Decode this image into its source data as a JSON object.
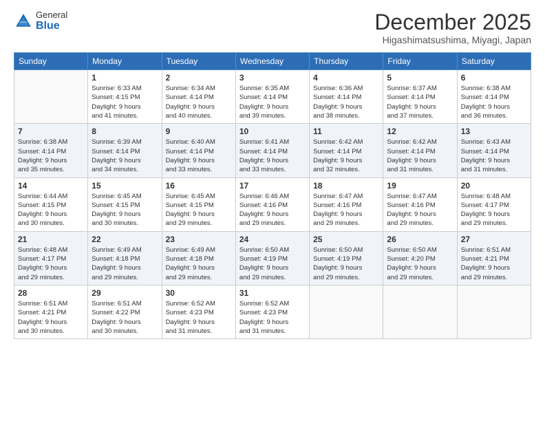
{
  "logo": {
    "general": "General",
    "blue": "Blue"
  },
  "title": "December 2025",
  "location": "Higashimatsushima, Miyagi, Japan",
  "days_header": [
    "Sunday",
    "Monday",
    "Tuesday",
    "Wednesday",
    "Thursday",
    "Friday",
    "Saturday"
  ],
  "weeks": [
    [
      {
        "day": "",
        "info": ""
      },
      {
        "day": "1",
        "info": "Sunrise: 6:33 AM\nSunset: 4:15 PM\nDaylight: 9 hours\nand 41 minutes."
      },
      {
        "day": "2",
        "info": "Sunrise: 6:34 AM\nSunset: 4:14 PM\nDaylight: 9 hours\nand 40 minutes."
      },
      {
        "day": "3",
        "info": "Sunrise: 6:35 AM\nSunset: 4:14 PM\nDaylight: 9 hours\nand 39 minutes."
      },
      {
        "day": "4",
        "info": "Sunrise: 6:36 AM\nSunset: 4:14 PM\nDaylight: 9 hours\nand 38 minutes."
      },
      {
        "day": "5",
        "info": "Sunrise: 6:37 AM\nSunset: 4:14 PM\nDaylight: 9 hours\nand 37 minutes."
      },
      {
        "day": "6",
        "info": "Sunrise: 6:38 AM\nSunset: 4:14 PM\nDaylight: 9 hours\nand 36 minutes."
      }
    ],
    [
      {
        "day": "7",
        "info": "Sunrise: 6:38 AM\nSunset: 4:14 PM\nDaylight: 9 hours\nand 35 minutes."
      },
      {
        "day": "8",
        "info": "Sunrise: 6:39 AM\nSunset: 4:14 PM\nDaylight: 9 hours\nand 34 minutes."
      },
      {
        "day": "9",
        "info": "Sunrise: 6:40 AM\nSunset: 4:14 PM\nDaylight: 9 hours\nand 33 minutes."
      },
      {
        "day": "10",
        "info": "Sunrise: 6:41 AM\nSunset: 4:14 PM\nDaylight: 9 hours\nand 33 minutes."
      },
      {
        "day": "11",
        "info": "Sunrise: 6:42 AM\nSunset: 4:14 PM\nDaylight: 9 hours\nand 32 minutes."
      },
      {
        "day": "12",
        "info": "Sunrise: 6:42 AM\nSunset: 4:14 PM\nDaylight: 9 hours\nand 31 minutes."
      },
      {
        "day": "13",
        "info": "Sunrise: 6:43 AM\nSunset: 4:14 PM\nDaylight: 9 hours\nand 31 minutes."
      }
    ],
    [
      {
        "day": "14",
        "info": "Sunrise: 6:44 AM\nSunset: 4:15 PM\nDaylight: 9 hours\nand 30 minutes."
      },
      {
        "day": "15",
        "info": "Sunrise: 6:45 AM\nSunset: 4:15 PM\nDaylight: 9 hours\nand 30 minutes."
      },
      {
        "day": "16",
        "info": "Sunrise: 6:45 AM\nSunset: 4:15 PM\nDaylight: 9 hours\nand 29 minutes."
      },
      {
        "day": "17",
        "info": "Sunrise: 6:46 AM\nSunset: 4:16 PM\nDaylight: 9 hours\nand 29 minutes."
      },
      {
        "day": "18",
        "info": "Sunrise: 6:47 AM\nSunset: 4:16 PM\nDaylight: 9 hours\nand 29 minutes."
      },
      {
        "day": "19",
        "info": "Sunrise: 6:47 AM\nSunset: 4:16 PM\nDaylight: 9 hours\nand 29 minutes."
      },
      {
        "day": "20",
        "info": "Sunrise: 6:48 AM\nSunset: 4:17 PM\nDaylight: 9 hours\nand 29 minutes."
      }
    ],
    [
      {
        "day": "21",
        "info": "Sunrise: 6:48 AM\nSunset: 4:17 PM\nDaylight: 9 hours\nand 29 minutes."
      },
      {
        "day": "22",
        "info": "Sunrise: 6:49 AM\nSunset: 4:18 PM\nDaylight: 9 hours\nand 29 minutes."
      },
      {
        "day": "23",
        "info": "Sunrise: 6:49 AM\nSunset: 4:18 PM\nDaylight: 9 hours\nand 29 minutes."
      },
      {
        "day": "24",
        "info": "Sunrise: 6:50 AM\nSunset: 4:19 PM\nDaylight: 9 hours\nand 29 minutes."
      },
      {
        "day": "25",
        "info": "Sunrise: 6:50 AM\nSunset: 4:19 PM\nDaylight: 9 hours\nand 29 minutes."
      },
      {
        "day": "26",
        "info": "Sunrise: 6:50 AM\nSunset: 4:20 PM\nDaylight: 9 hours\nand 29 minutes."
      },
      {
        "day": "27",
        "info": "Sunrise: 6:51 AM\nSunset: 4:21 PM\nDaylight: 9 hours\nand 29 minutes."
      }
    ],
    [
      {
        "day": "28",
        "info": "Sunrise: 6:51 AM\nSunset: 4:21 PM\nDaylight: 9 hours\nand 30 minutes."
      },
      {
        "day": "29",
        "info": "Sunrise: 6:51 AM\nSunset: 4:22 PM\nDaylight: 9 hours\nand 30 minutes."
      },
      {
        "day": "30",
        "info": "Sunrise: 6:52 AM\nSunset: 4:23 PM\nDaylight: 9 hours\nand 31 minutes."
      },
      {
        "day": "31",
        "info": "Sunrise: 6:52 AM\nSunset: 4:23 PM\nDaylight: 9 hours\nand 31 minutes."
      },
      {
        "day": "",
        "info": ""
      },
      {
        "day": "",
        "info": ""
      },
      {
        "day": "",
        "info": ""
      }
    ]
  ]
}
